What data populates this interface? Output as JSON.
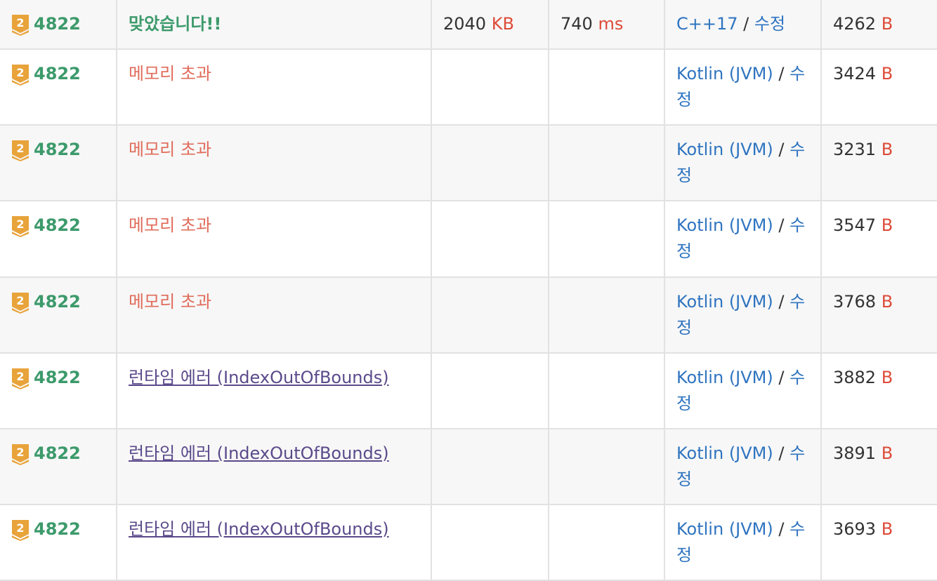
{
  "colors": {
    "accepted": "#3c9a6b",
    "memory_exceeded": "#e06c5b",
    "runtime_error": "#5b4a8b",
    "unit": "#dd4b39",
    "link": "#2f74c0",
    "tier_gold": "#e8a33a"
  },
  "tier_icon": "gold-tier-2-icon",
  "tier_label": "2",
  "rows": [
    {
      "problem": "4822",
      "result": "맞았습니다!!",
      "result_type": "accepted",
      "memory": "2040",
      "memory_unit": "KB",
      "time": "740",
      "time_unit": "ms",
      "language": "C++17",
      "edit": "수정",
      "code_length": "4262",
      "code_unit": "B"
    },
    {
      "problem": "4822",
      "result": "메모리 초과",
      "result_type": "memory_exceeded",
      "memory": "",
      "memory_unit": "",
      "time": "",
      "time_unit": "",
      "language": "Kotlin (JVM)",
      "edit": "수정",
      "code_length": "3424",
      "code_unit": "B"
    },
    {
      "problem": "4822",
      "result": "메모리 초과",
      "result_type": "memory_exceeded",
      "memory": "",
      "memory_unit": "",
      "time": "",
      "time_unit": "",
      "language": "Kotlin (JVM)",
      "edit": "수정",
      "code_length": "3231",
      "code_unit": "B"
    },
    {
      "problem": "4822",
      "result": "메모리 초과",
      "result_type": "memory_exceeded",
      "memory": "",
      "memory_unit": "",
      "time": "",
      "time_unit": "",
      "language": "Kotlin (JVM)",
      "edit": "수정",
      "code_length": "3547",
      "code_unit": "B"
    },
    {
      "problem": "4822",
      "result": "메모리 초과",
      "result_type": "memory_exceeded",
      "memory": "",
      "memory_unit": "",
      "time": "",
      "time_unit": "",
      "language": "Kotlin (JVM)",
      "edit": "수정",
      "code_length": "3768",
      "code_unit": "B"
    },
    {
      "problem": "4822",
      "result": "런타임 에러 (IndexOutOfBounds)",
      "result_type": "runtime_error",
      "memory": "",
      "memory_unit": "",
      "time": "",
      "time_unit": "",
      "language": "Kotlin (JVM)",
      "edit": "수정",
      "code_length": "3882",
      "code_unit": "B"
    },
    {
      "problem": "4822",
      "result": "런타임 에러 (IndexOutOfBounds)",
      "result_type": "runtime_error",
      "memory": "",
      "memory_unit": "",
      "time": "",
      "time_unit": "",
      "language": "Kotlin (JVM)",
      "edit": "수정",
      "code_length": "3891",
      "code_unit": "B"
    },
    {
      "problem": "4822",
      "result": "런타임 에러 (IndexOutOfBounds)",
      "result_type": "runtime_error",
      "memory": "",
      "memory_unit": "",
      "time": "",
      "time_unit": "",
      "language": "Kotlin (JVM)",
      "edit": "수정",
      "code_length": "3693",
      "code_unit": "B"
    }
  ]
}
